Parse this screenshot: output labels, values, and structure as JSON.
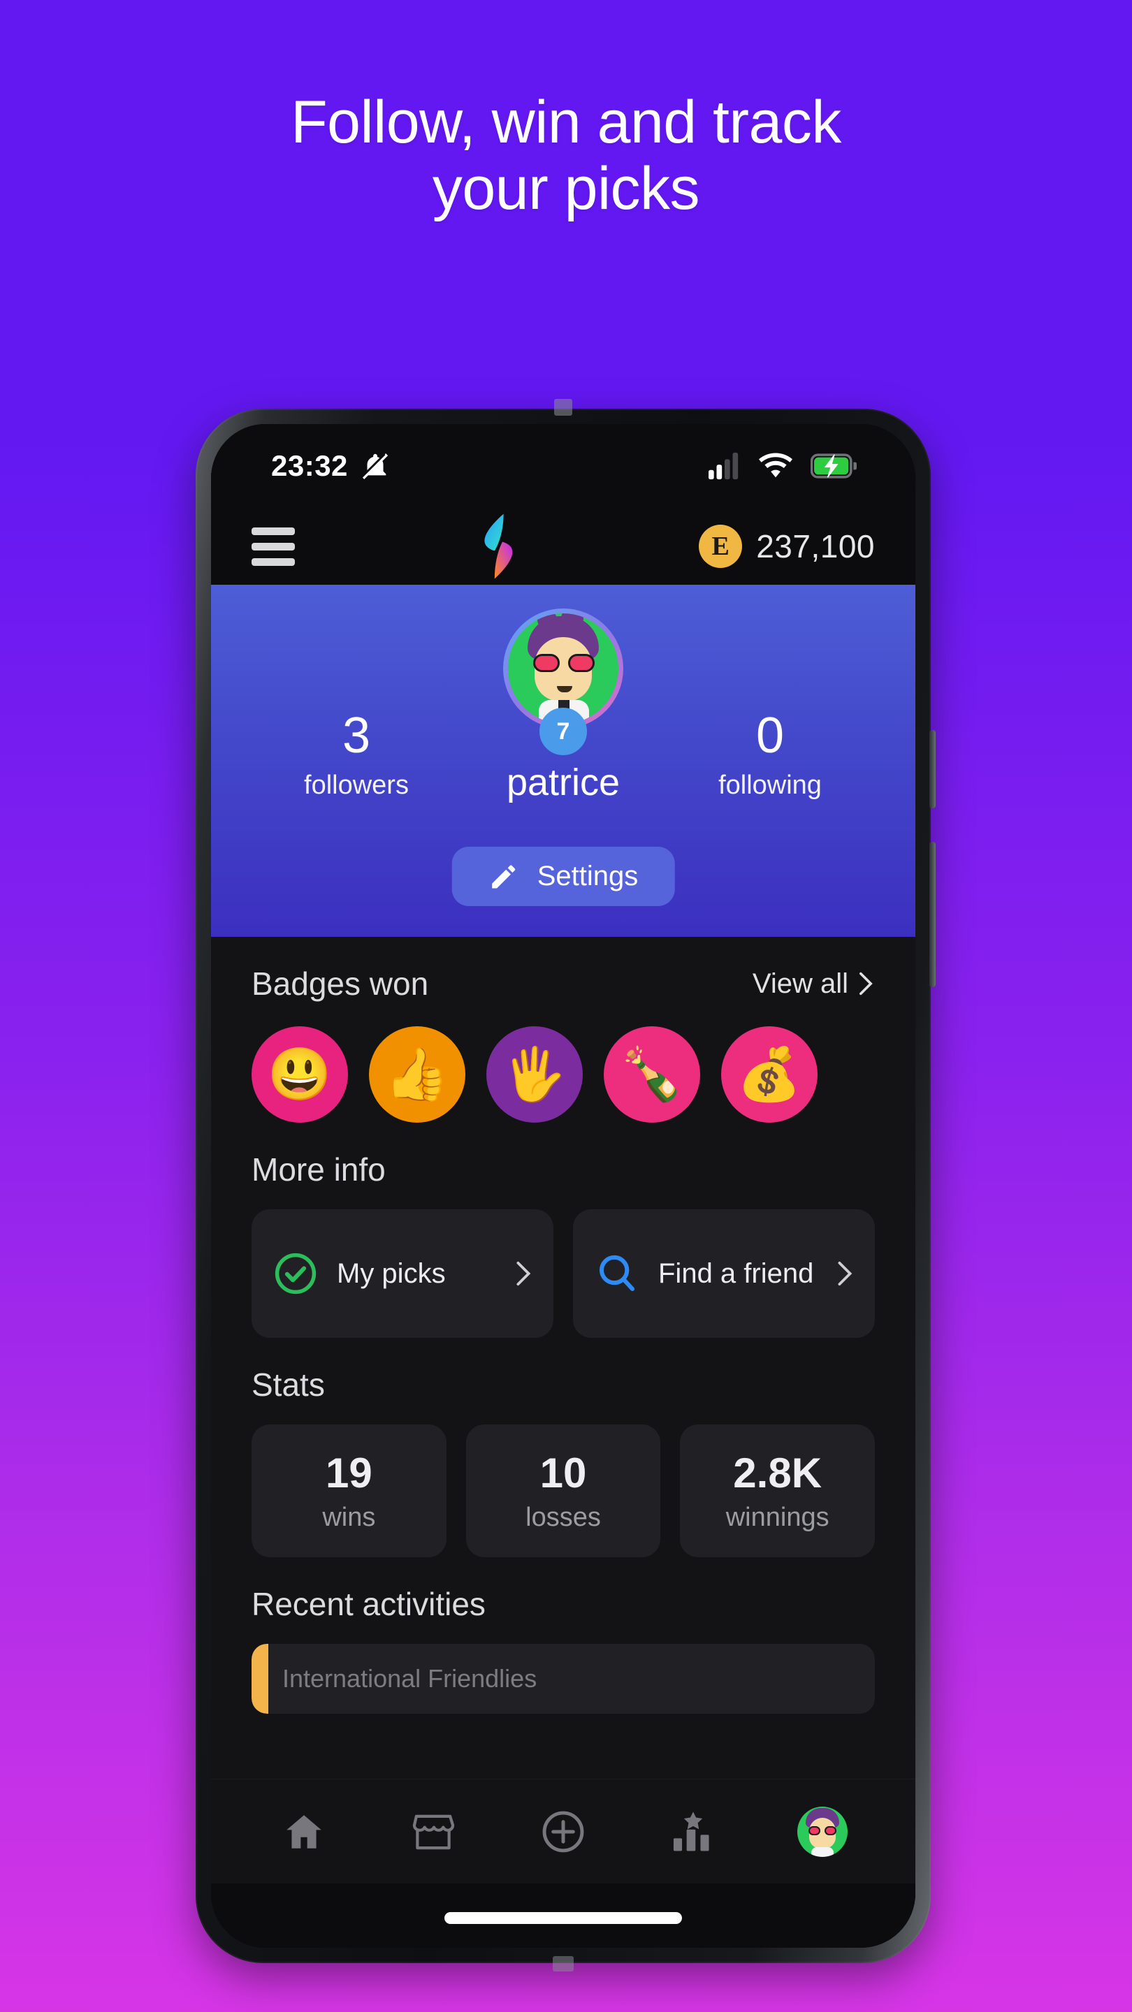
{
  "promo": {
    "headline_line1": "Follow, win and track",
    "headline_line2": "your picks",
    "bg_top_color": "#6318F2",
    "bg_bottom_color": "#D635E6"
  },
  "status_bar": {
    "time": "23:32",
    "notification_icon": "bell-muted-icon",
    "signal_icon": "cellular-signal-icon",
    "signal_bars_filled": 2,
    "signal_bars_total": 4,
    "wifi_icon": "wifi-icon",
    "battery_icon": "battery-charging-icon",
    "battery_color": "#2ECC40"
  },
  "app_bar": {
    "menu_icon": "hamburger-menu-icon",
    "logo_icon": "flame-logo-icon",
    "coin_symbol": "E",
    "coin_balance": "237,100",
    "coin_color": "#F0B843"
  },
  "profile": {
    "followers_count": "3",
    "followers_label": "followers",
    "following_count": "0",
    "following_label": "following",
    "username": "patrice",
    "level": "7",
    "level_badge_color": "#4A9BEA",
    "avatar_icon": "user-avatar",
    "settings_label": "Settings",
    "settings_icon": "pencil-icon",
    "settings_btn_color": "#5664DC"
  },
  "badges_section": {
    "title": "Badges won",
    "view_all_label": "View all",
    "chevron_icon": "chevron-right-icon",
    "badges": [
      {
        "name": "smiley-badge",
        "glyph": "😃",
        "bg": "#E8237F"
      },
      {
        "name": "thumbs-up-badge",
        "glyph": "👍",
        "bg": "#F29100"
      },
      {
        "name": "high-five-badge",
        "glyph": "🖐",
        "bg": "#7B2C9E"
      },
      {
        "name": "celebration-badge",
        "glyph": "🍾",
        "bg": "#ED2E7E"
      },
      {
        "name": "winnings-badge",
        "glyph": "💰",
        "bg": "#ED2E7E"
      }
    ]
  },
  "more_info": {
    "title": "More info",
    "items": [
      {
        "name": "my-picks",
        "label": "My picks",
        "icon": "check-circle-icon",
        "color": "#2BBE5A"
      },
      {
        "name": "find-a-friend",
        "label": "Find a friend",
        "icon": "search-icon",
        "color": "#2E8BF5"
      }
    ]
  },
  "stats": {
    "title": "Stats",
    "items": [
      {
        "value": "19",
        "label": "wins"
      },
      {
        "value": "10",
        "label": "losses"
      },
      {
        "value": "2.8K",
        "label": "winnings"
      }
    ]
  },
  "recent_activities": {
    "title": "Recent activities",
    "first_item_preview": "International Friendlies",
    "accent_color": "#F3B54B"
  },
  "bottom_nav": [
    {
      "name": "nav-home",
      "icon": "home-icon"
    },
    {
      "name": "nav-store",
      "icon": "store-icon"
    },
    {
      "name": "nav-create",
      "icon": "plus-circle-icon"
    },
    {
      "name": "nav-leaderboard",
      "icon": "leaderboard-icon"
    },
    {
      "name": "nav-profile",
      "icon": "avatar-icon"
    }
  ]
}
